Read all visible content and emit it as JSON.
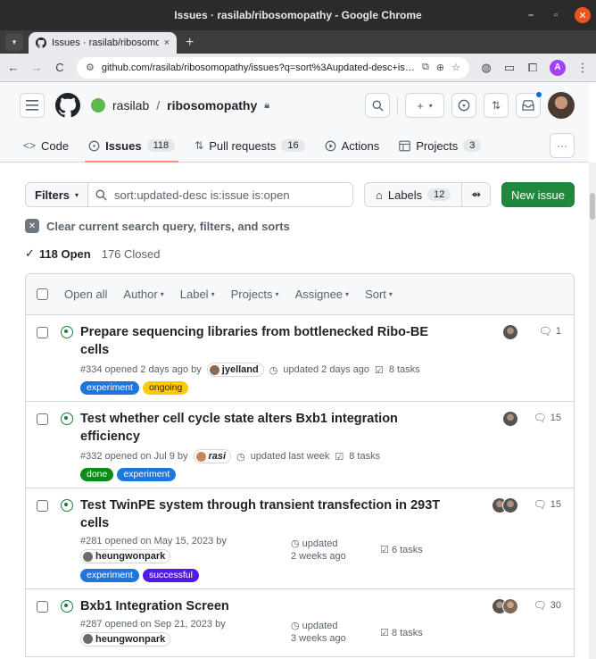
{
  "window": {
    "title": "Issues · rasilab/ribosomopathy - Google Chrome",
    "minimize": "–",
    "maximize": "▫",
    "close": "✕"
  },
  "browser": {
    "tab_title": "Issues · rasilab/ribosomo",
    "tab_close": "×",
    "new_tab": "+",
    "url": "github.com/rasilab/ribosomopathy/issues?q=sort%3Aupdated-desc+is%3Ai...",
    "profile_initial": "A"
  },
  "header": {
    "owner": "rasilab",
    "path_sep": "/",
    "repo": "ribosomopathy"
  },
  "repo_tabs": [
    {
      "label": "Code",
      "icon": "code-icon"
    },
    {
      "label": "Issues",
      "icon": "issue-icon",
      "count": "118"
    },
    {
      "label": "Pull requests",
      "icon": "pull-request-icon",
      "count": "16"
    },
    {
      "label": "Actions",
      "icon": "play-icon"
    },
    {
      "label": "Projects",
      "icon": "table-icon",
      "count": "3"
    }
  ],
  "toolbar": {
    "filters_label": "Filters",
    "search_value": "sort:updated-desc is:issue is:open",
    "labels_label": "Labels",
    "labels_count": "12",
    "new_issue_label": "New issue"
  },
  "clear_filter_text": "Clear current search query, filters, and sorts",
  "states": {
    "open": "118 Open",
    "closed": "176 Closed"
  },
  "list_header": {
    "open_all": "Open all",
    "menus": [
      "Author",
      "Label",
      "Projects",
      "Assignee",
      "Sort"
    ]
  },
  "issues": [
    {
      "title": "Prepare sequencing libraries from bottlenecked Ribo-BE cells",
      "opened": "#334 opened 2 days ago by",
      "user": "jyelland",
      "updated": "updated 2 days ago",
      "tasks": "8 tasks",
      "comments": "1",
      "labels": [
        {
          "name": "experiment",
          "bg": "#1d76db",
          "fg": "#ffffff"
        },
        {
          "name": "ongoing",
          "bg": "#fbca04",
          "fg": "#1f2328"
        }
      ]
    },
    {
      "title": "Test whether cell cycle state alters Bxb1 integration efficiency",
      "opened": "#332 opened on Jul 9 by",
      "user": "rasi",
      "updated": "updated last week",
      "tasks": "8 tasks",
      "comments": "15",
      "labels": [
        {
          "name": "done",
          "bg": "#0e8a16",
          "fg": "#ffffff"
        },
        {
          "name": "experiment",
          "bg": "#1d76db",
          "fg": "#ffffff"
        }
      ]
    },
    {
      "title": "Test TwinPE system through transient transfection in 293T cells",
      "opened": "#281 opened on May 15, 2023 by",
      "user": "heungwonpark",
      "updated_line1": "updated",
      "updated_line2": "2 weeks ago",
      "tasks": "6 tasks",
      "comments": "15",
      "labels": [
        {
          "name": "experiment",
          "bg": "#1d76db",
          "fg": "#ffffff"
        },
        {
          "name": "successful",
          "bg": "#5319e7",
          "fg": "#ffffff"
        }
      ]
    },
    {
      "title": "Bxb1 Integration Screen",
      "opened": "#287 opened on Sep 21, 2023 by",
      "user": "heungwonpark",
      "updated_line1": "updated",
      "updated_line2": "3 weeks ago",
      "tasks": "8 tasks",
      "comments": "30",
      "labels": []
    }
  ],
  "colors": {
    "accent_green": "#1f883d",
    "open_issue": "#1a7f37",
    "selected_tab_underline": "#fd8c73",
    "notification_dot": "#0969da"
  }
}
